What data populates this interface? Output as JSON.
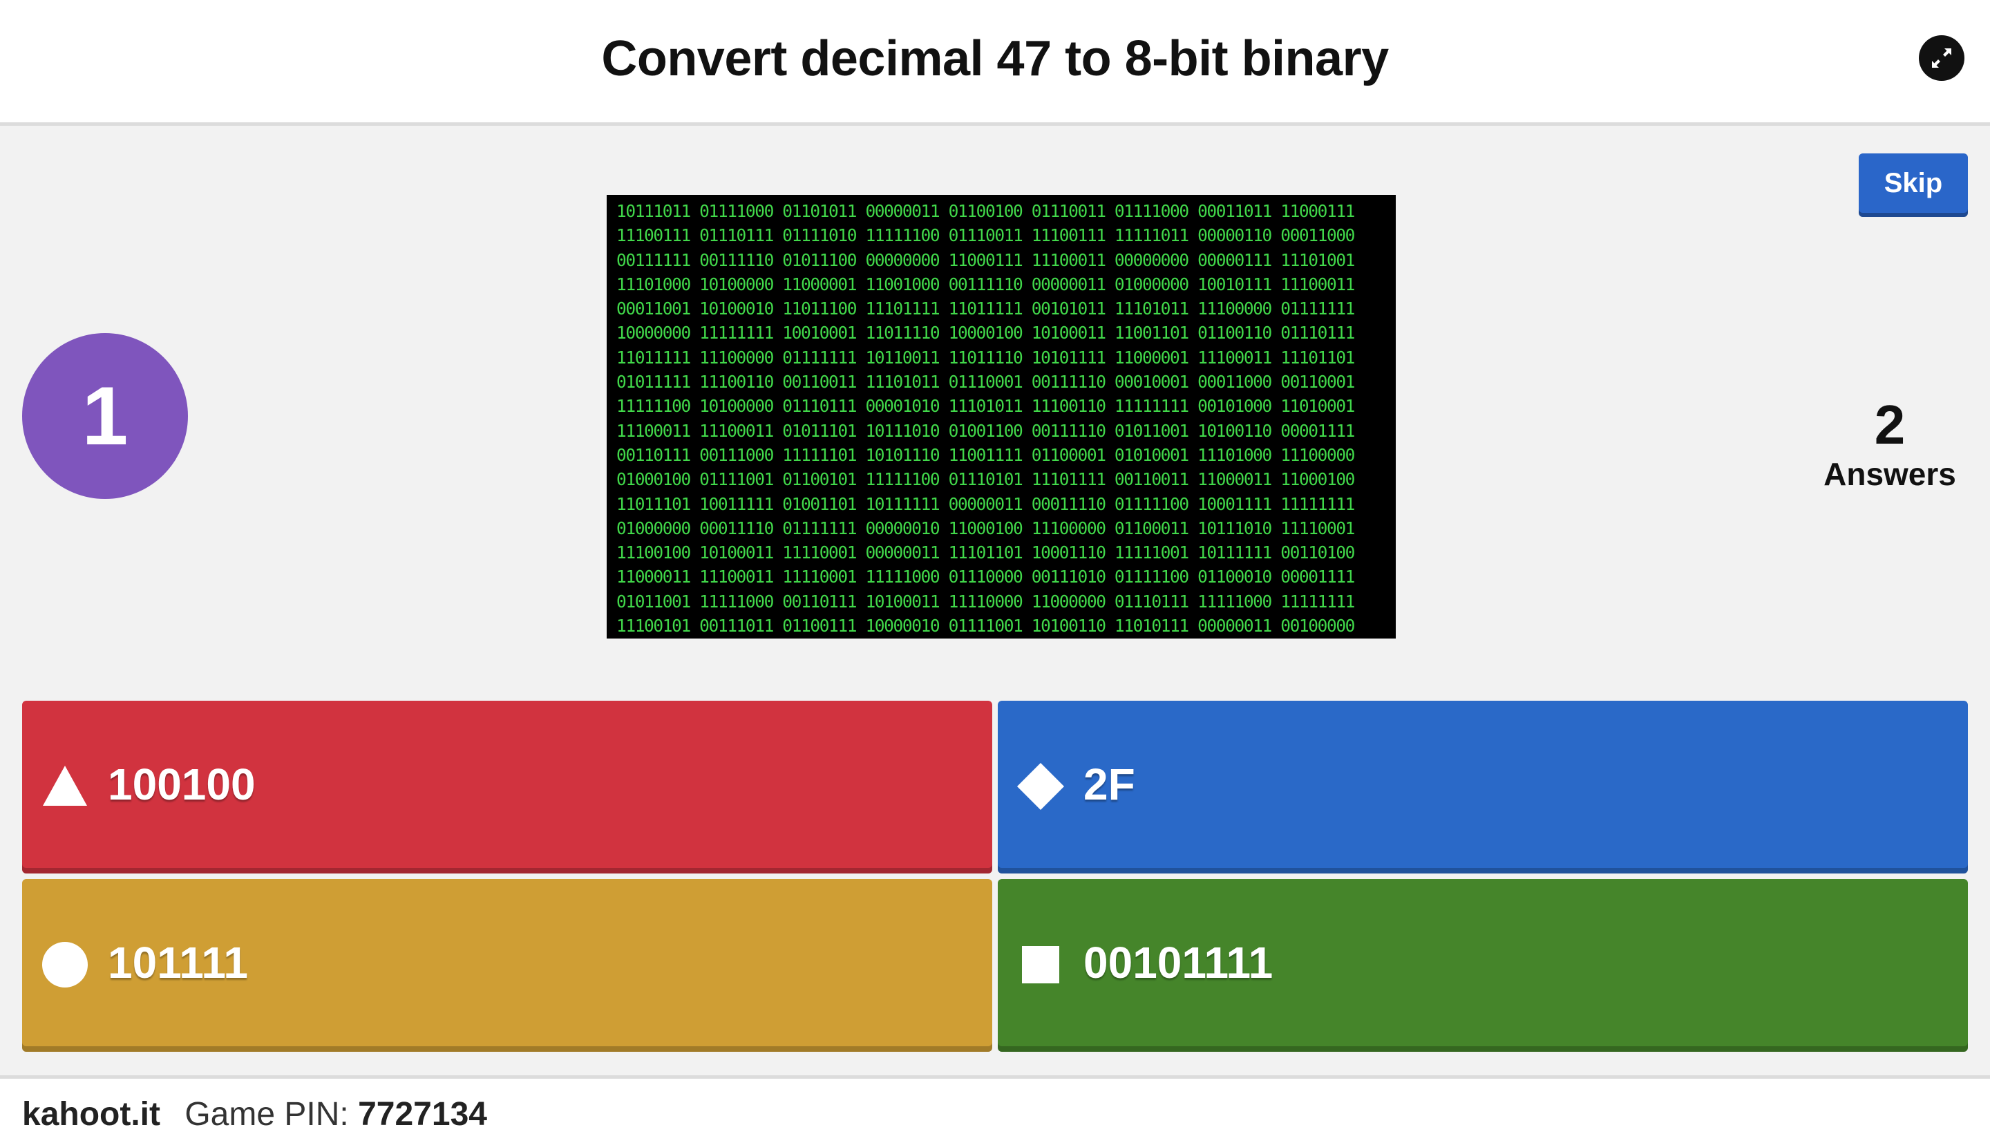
{
  "header": {
    "question": "Convert decimal 47 to 8-bit binary",
    "fullscreen_icon": "fullscreen-exit-icon"
  },
  "stage": {
    "timer": "1",
    "skip_label": "Skip",
    "answers_count": "2",
    "answers_label": "Answers",
    "media_lines": [
      "10111011 01111000 01101011 00000011 01100100 01110011 01111000 00011011 11000111",
      "11100111 01110111 01111010 11111100 01110011 11100111 11111011 00000110 00011000",
      "00111111 00111110 01011100 00000000 11000111 11100011 00000000 00000111 11101001",
      "11101000 10100000 11000001 11001000 00111110 00000011 01000000 10010111 11100011",
      "00011001 10100010 11011100 11101111 11011111 00101011 11101011 11100000 01111111",
      "10000000 11111111 10010001 11011110 10000100 10100011 11001101 01100110 01110111",
      "11011111 11100000 01111111 10110011 11011110 10101111 11000001 11100011 11101101",
      "01011111 11100110 00110011 11101011 01110001 00111110 00010001 00011000 00110001",
      "11111100 10100000 01110111 00001010 11101011 11100110 11111111 00101000 11010001",
      "11100011 11100011 01011101 10111010 01001100 00111110 01011001 10100110 00001111",
      "00110111 00111000 11111101 10101110 11001111 01100001 01010001 11101000 11100000",
      "01000100 01111001 01100101 11111100 01110101 11101111 00110011 11000011 11000100",
      "11011101 10011111 01001101 10111111 00000011 00011110 01111100 10001111 11111111",
      "01000000 00011110 01111111 00000010 11000100 11100000 01100011 10111010 11110001",
      "11100100 10100011 11110001 00000011 11101101 10001110 11111001 10111111 00110100",
      "11000011 11100011 11110001 11111000 01110000 00111010 01111100 01100010 00001111",
      "01011001 11111000 00110111 10100011 11110000 11000000 01110111 11111000 11111111",
      "11100101 00111011 01100111 10000010 01111001 10100110 11010111 00000011 00100000"
    ]
  },
  "answers": [
    {
      "text": "100100",
      "shape": "triangle-icon",
      "color": "#d1333f"
    },
    {
      "text": "2F",
      "shape": "diamond-icon",
      "color": "#2a69c8"
    },
    {
      "text": "101111",
      "shape": "circle-icon",
      "color": "#cf9e34"
    },
    {
      "text": "00101111",
      "shape": "square-icon",
      "color": "#45852a"
    }
  ],
  "footer": {
    "brand": "kahoot.it",
    "pin_label": "Game PIN:",
    "pin_value": "7727134"
  }
}
